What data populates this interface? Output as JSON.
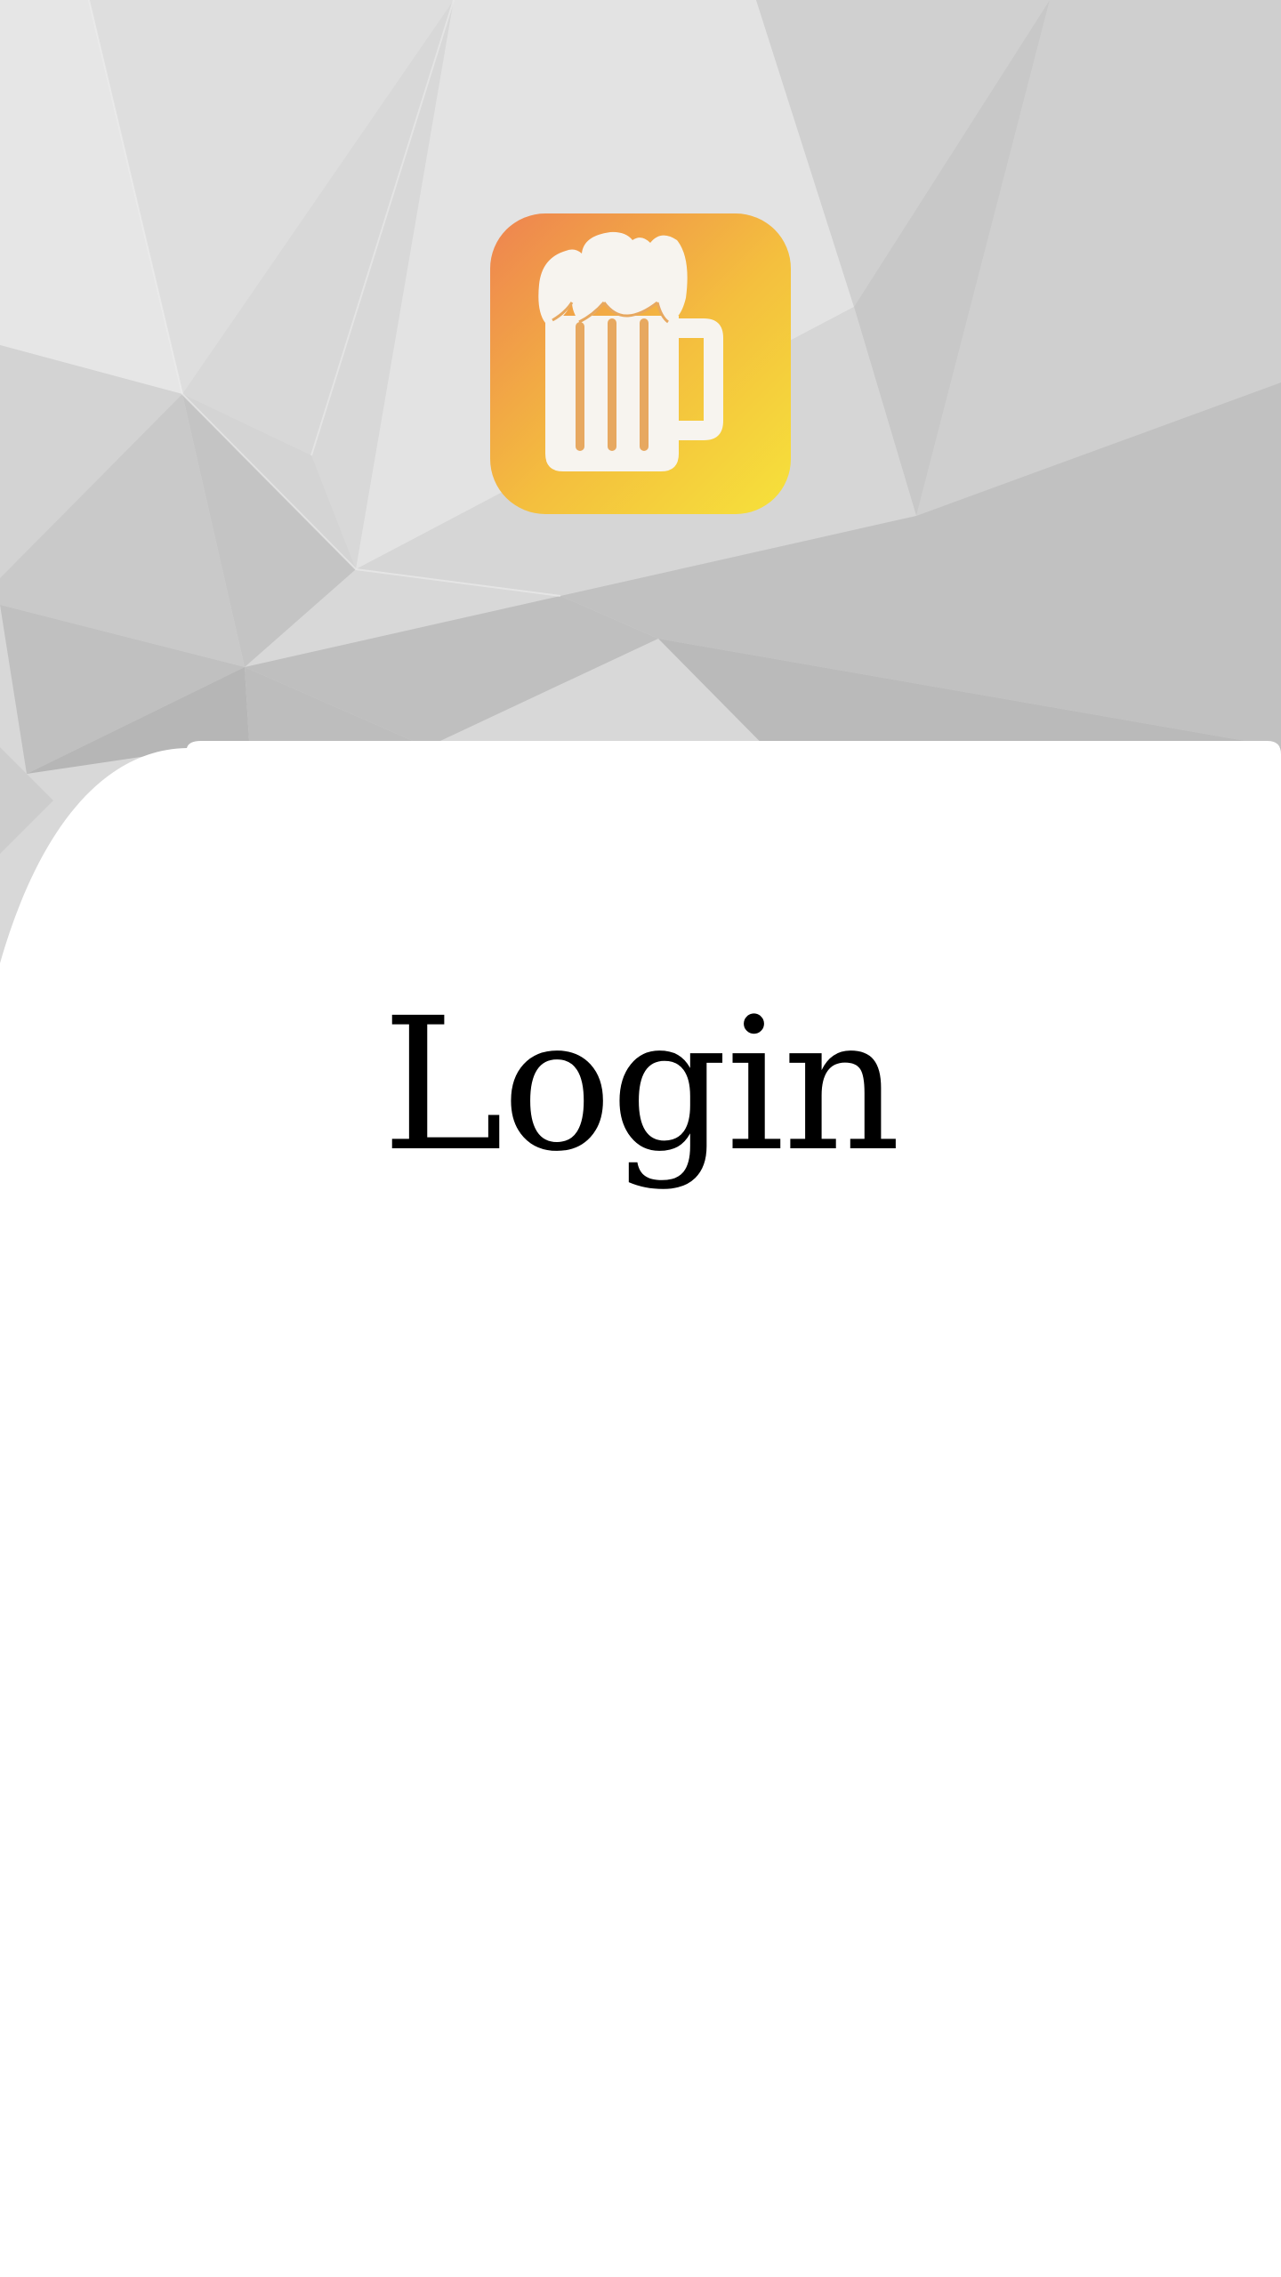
{
  "screen": {
    "title": "Login"
  },
  "header": {
    "logo_icon": "beer-mug-icon"
  },
  "colors": {
    "background_light": "#e2e2e2",
    "background_dark": "#b8b8b8",
    "logo_orange": "#ee8a4e",
    "logo_yellow": "#f6d23a",
    "mug_white": "#f7f4ef",
    "card": "#ffffff",
    "title_text": "#000000"
  }
}
